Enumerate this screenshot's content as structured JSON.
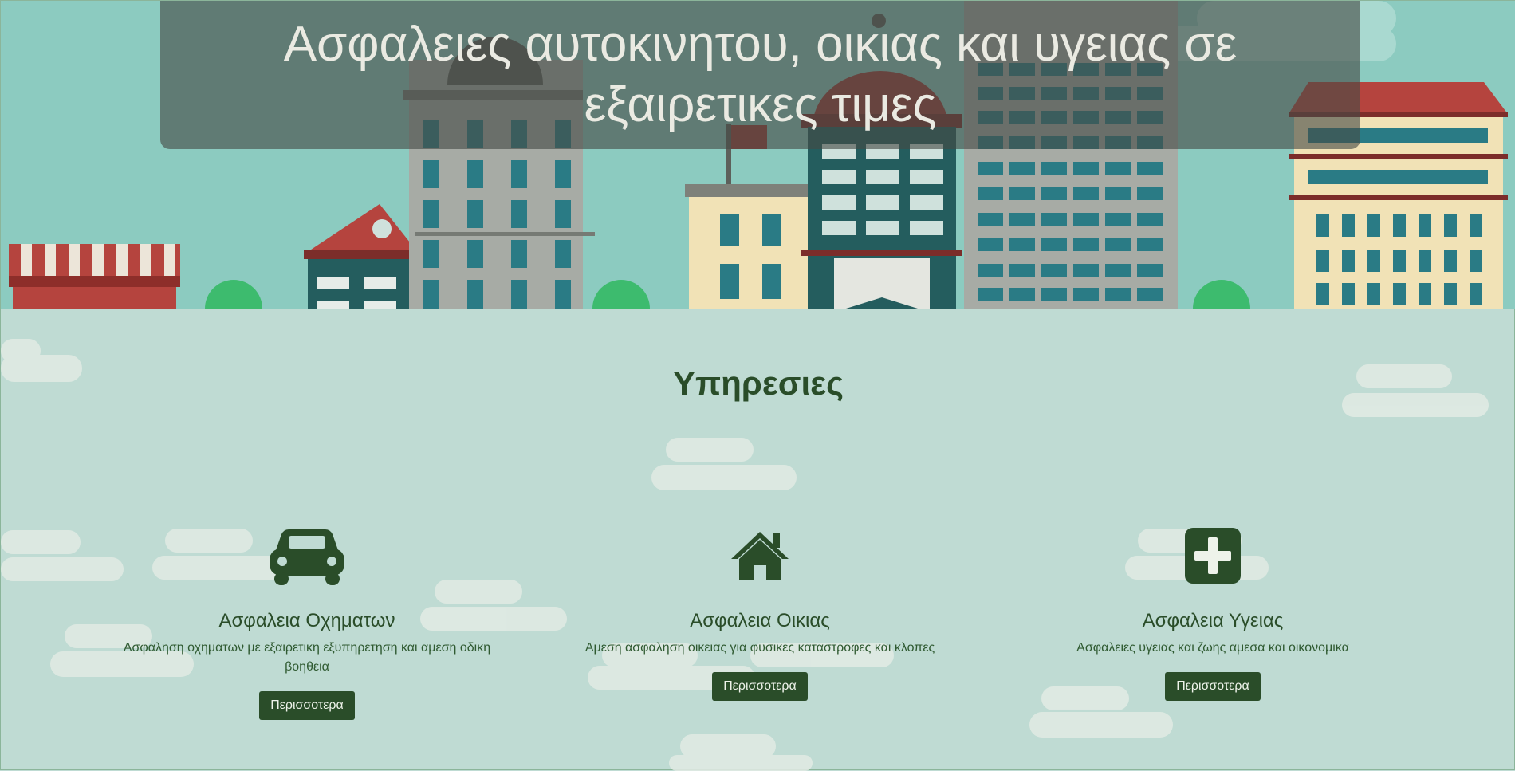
{
  "hero": {
    "title": "Ασφαλειες αυτοκινητου, οικιας και υγειας σε εξαιρετικες τιμες"
  },
  "services": {
    "title": "Υπηρεσιες",
    "items": [
      {
        "icon": "car-icon",
        "title": "Ασφαλεια Οχηματων",
        "description": "Ασφαληση οχηματων με εξαιρετικη εξυπηρετηση και αμεση οδικη βοηθεια",
        "button": "Περισσοτερα"
      },
      {
        "icon": "home-icon",
        "title": "Ασφαλεια Οικιας",
        "description": "Αμεση ασφαληση οικειας για φυσικες καταστροφες και κλοπες",
        "button": "Περισσοτερα"
      },
      {
        "icon": "health-plus-icon",
        "title": "Ασφαλεια Υγειας",
        "description": "Ασφαλειες υγειας και ζωης αμεσα και οικονομικα",
        "button": "Περισσοτερα"
      }
    ]
  },
  "colors": {
    "accent": "#2a4d29",
    "sky": "#8ccbc0",
    "section_bg": "#bfdbd3"
  }
}
